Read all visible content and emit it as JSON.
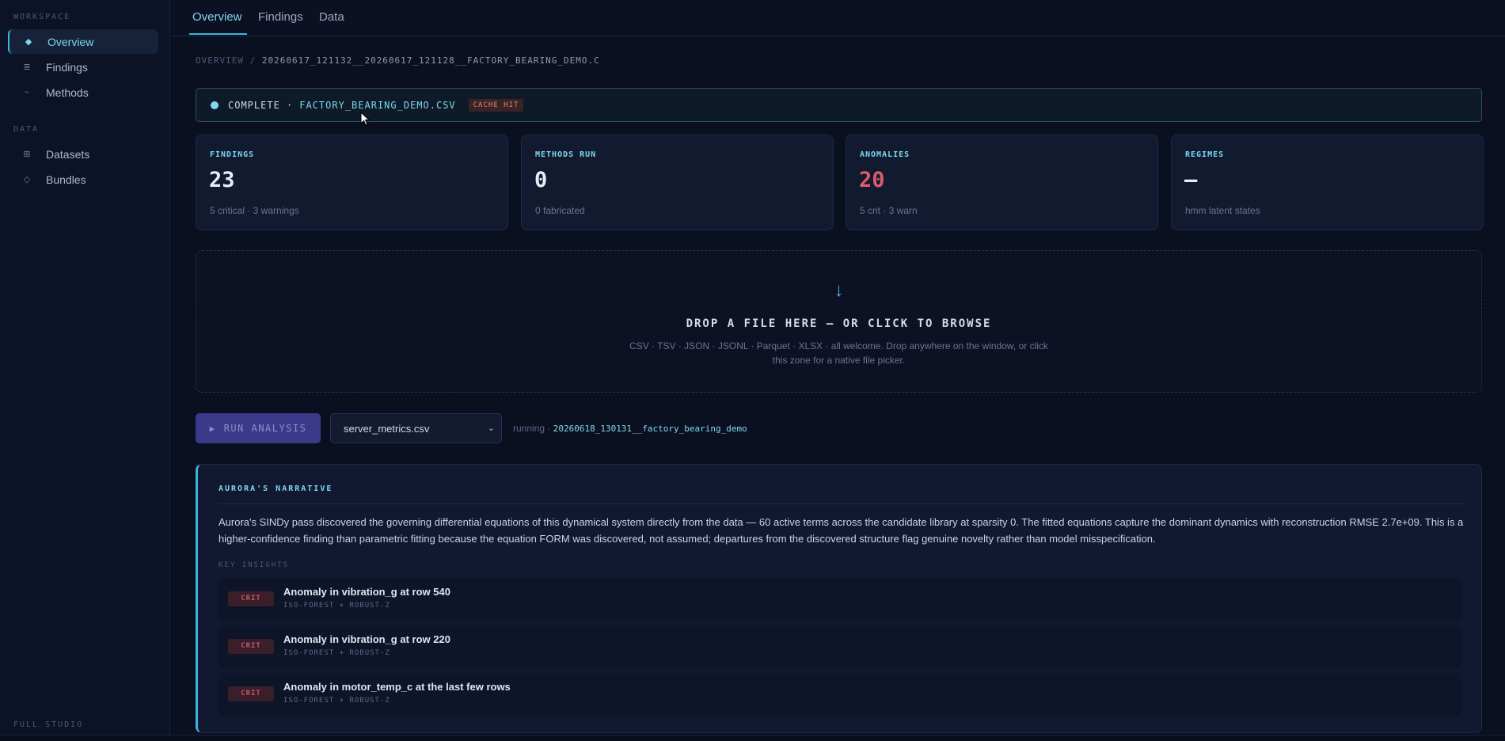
{
  "sidebar": {
    "workspace_label": "WORKSPACE",
    "data_label": "DATA",
    "footer_label": "FULL STUDIO",
    "items": [
      {
        "label": "Overview",
        "icon": "diamond-icon"
      },
      {
        "label": "Findings",
        "icon": "list-icon"
      },
      {
        "label": "Methods",
        "icon": "wave-icon"
      },
      {
        "label": "Datasets",
        "icon": "grid-icon"
      },
      {
        "label": "Bundles",
        "icon": "bundle-icon"
      }
    ]
  },
  "tabs": [
    "Overview",
    "Findings",
    "Data"
  ],
  "breadcrumb": {
    "root": "OVERVIEW",
    "sep": "/",
    "current": "20260617_121132__20260617_121128__FACTORY_BEARING_DEMO.C"
  },
  "status": {
    "state": "COMPLETE ·",
    "file": "FACTORY_BEARING_DEMO.CSV",
    "badge": "CACHE HIT"
  },
  "cards": [
    {
      "label": "FINDINGS",
      "value": "23",
      "sub": "5 critical · 3 warnings"
    },
    {
      "label": "METHODS RUN",
      "value": "0",
      "sub": "0 fabricated"
    },
    {
      "label": "ANOMALIES",
      "value": "20",
      "sub": "5 crit · 3 warn"
    },
    {
      "label": "REGIMES",
      "value": "–",
      "sub": "hmm latent states"
    }
  ],
  "dropzone": {
    "arrow": "↓",
    "title": "DROP A FILE HERE — OR CLICK TO BROWSE",
    "desc": "CSV · TSV · JSON · JSONL · Parquet · XLSX · all welcome. Drop anywhere on the window, or click this zone for a native file picker."
  },
  "run": {
    "button": "RUN ANALYSIS",
    "selected_file": "server_metrics.csv",
    "running_label": "running ·",
    "running_id": "20260618_130131__factory_bearing_demo"
  },
  "narrative": {
    "title": "AURORA'S NARRATIVE",
    "body": "Aurora's SINDy pass discovered the governing differential equations of this dynamical system directly from the data — 60 active terms across the candidate library at sparsity 0. The fitted equations capture the dominant dynamics with reconstruction RMSE 2.7e+09. This is a higher-confidence finding than parametric fitting because the equation FORM was discovered, not assumed; departures from the discovered structure flag genuine novelty rather than model misspecification.",
    "key_insights_label": "KEY INSIGHTS",
    "insights": [
      {
        "badge": "CRIT",
        "title": "Anomaly in vibration_g at row 540",
        "meta": "ISO-FOREST + ROBUST-Z"
      },
      {
        "badge": "CRIT",
        "title": "Anomaly in vibration_g at row 220",
        "meta": "ISO-FOREST + ROBUST-Z"
      },
      {
        "badge": "CRIT",
        "title": "Anomaly in motor_temp_c at the last few rows",
        "meta": "ISO-FOREST + ROBUST-Z"
      }
    ]
  },
  "colors": {
    "accent": "#39b6d8",
    "critical": "#e05a6a",
    "background": "#0b1020"
  }
}
